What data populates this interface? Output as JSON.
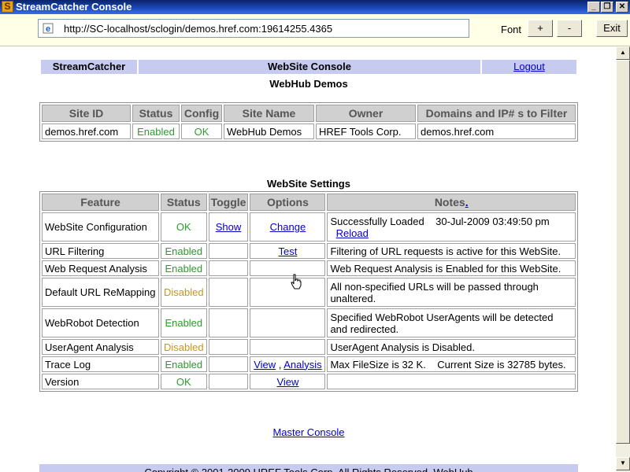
{
  "window": {
    "title": "StreamCatcher Console",
    "app_icon_letter": "S",
    "minimize": "_",
    "restore": "❐",
    "close": "✕"
  },
  "toolbar": {
    "url": "http://SC-localhost/sclogin/demos.href.com:19614255.4365",
    "font_label": "Font",
    "plus": "+",
    "minus": "-",
    "exit": "Exit"
  },
  "header": {
    "brand": "StreamCatcher",
    "title": "WebSite Console",
    "logout": "Logout",
    "subtitle": "WebHub Demos"
  },
  "site_table": {
    "headers": [
      "Site ID",
      "Status",
      "Config",
      "Site Name",
      "Owner",
      "Domains and IP# s to Filter"
    ],
    "row": {
      "site_id": "demos.href.com",
      "status": "Enabled",
      "config": "OK",
      "site_name": "WebHub Demos",
      "owner": "HREF Tools Corp.",
      "domains": "demos.href.com"
    }
  },
  "settings": {
    "title": "WebSite Settings",
    "headers": {
      "feature": "Feature",
      "status": "Status",
      "toggle": "Toggle",
      "options": "Options",
      "notes": "Notes",
      "notes_link": "."
    },
    "rows": [
      {
        "feature": "WebSite Configuration",
        "status": "OK",
        "toggle": "Show",
        "option1": "Change",
        "sep": "",
        "option2": "",
        "notes": "Successfully Loaded    30-Jul-2009 03:49:50 pm",
        "notes_link": "Reload"
      },
      {
        "feature": "URL Filtering",
        "status": "Enabled",
        "toggle": "",
        "option1": "Test",
        "sep": "",
        "option2": "",
        "notes": "Filtering of URL requests is active for this WebSite.",
        "notes_link": ""
      },
      {
        "feature": "Web Request Analysis",
        "status": "Enabled",
        "toggle": "",
        "option1": "",
        "sep": "",
        "option2": "",
        "notes": "Web Request Analysis is Enabled for this WebSite.",
        "notes_link": ""
      },
      {
        "feature": "Default URL ReMapping",
        "status": "Disabled",
        "toggle": "",
        "option1": "",
        "sep": "",
        "option2": "",
        "notes": "All non-specified URLs will be passed through unaltered.",
        "notes_link": ""
      },
      {
        "feature": "WebRobot Detection",
        "status": "Enabled",
        "toggle": "",
        "option1": "",
        "sep": "",
        "option2": "",
        "notes": "Specified WebRobot UserAgents will be detected and redirected.",
        "notes_link": ""
      },
      {
        "feature": "UserAgent Analysis",
        "status": "Disabled",
        "toggle": "",
        "option1": "",
        "sep": "",
        "option2": "",
        "notes": "UserAgent Analysis is Disabled.",
        "notes_link": ""
      },
      {
        "feature": "Trace Log",
        "status": "Enabled",
        "toggle": "",
        "option1": "View",
        "sep": " , ",
        "option2": "Analysis",
        "notes": "Max FileSize is 32 K.    Current Size is 32785 bytes.",
        "notes_link": ""
      },
      {
        "feature": "Version",
        "status": "OK",
        "toggle": "",
        "option1": "View",
        "sep": "",
        "option2": "",
        "notes": "",
        "notes_link": ""
      }
    ]
  },
  "master_console": "Master Console",
  "footer": "Copyright © 2001-2009 HREF Tools Corp. All Rights Reserved. WebHub",
  "colors": {
    "enabled": "#2e9a2e",
    "disabled": "#c8961e",
    "link": "#0000cc",
    "header_band": "#c8cbf0"
  }
}
